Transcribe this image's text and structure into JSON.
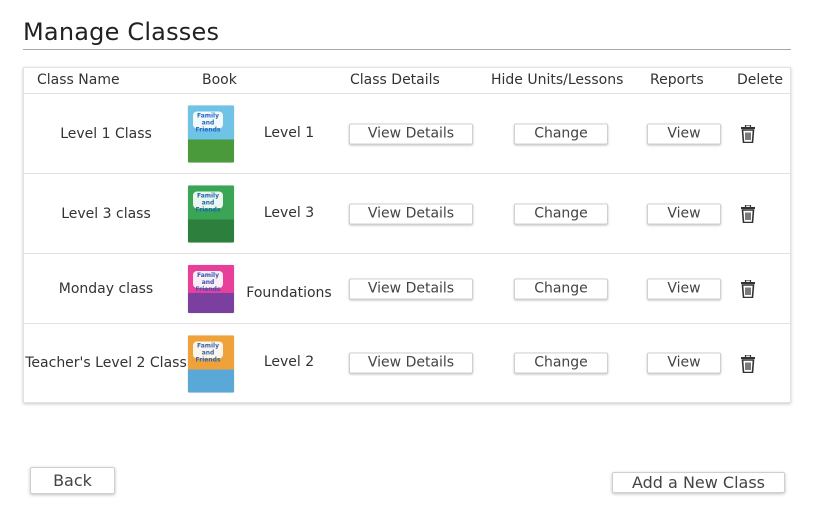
{
  "page": {
    "title": "Manage Classes"
  },
  "table": {
    "headers": {
      "class_name": "Class Name",
      "book": "Book",
      "class_details": "Class Details",
      "hide": "Hide Units/Lessons",
      "reports": "Reports",
      "delete": "Delete"
    },
    "rows": [
      {
        "class_name": "Level 1 Class",
        "level": "Level 1",
        "book_title": "Family and Friends",
        "book_colors": [
          "#6fc3e6",
          "#4a9a3c"
        ],
        "details_label": "View Details",
        "change_label": "Change",
        "report_label": "View"
      },
      {
        "class_name": "Level 3 class",
        "level": "Level 3",
        "book_title": "Family and Friends",
        "book_colors": [
          "#3aa655",
          "#2d7f3e"
        ],
        "details_label": "View Details",
        "change_label": "Change",
        "report_label": "View"
      },
      {
        "class_name": "Monday class",
        "level": "Foundations",
        "book_title": "Family and Friends",
        "book_colors": [
          "#e83f9a",
          "#7b3fa0"
        ],
        "details_label": "View Details",
        "change_label": "Change",
        "report_label": "View"
      },
      {
        "class_name": "Teacher's Level 2 Class",
        "level": "Level 2",
        "book_title": "Family and Friends",
        "book_colors": [
          "#f0a23a",
          "#5aa8d8"
        ],
        "details_label": "View Details",
        "change_label": "Change",
        "report_label": "View"
      }
    ]
  },
  "footer": {
    "back_label": "Back",
    "add_label": "Add a New Class"
  },
  "icons": {
    "delete": "trash-icon"
  }
}
